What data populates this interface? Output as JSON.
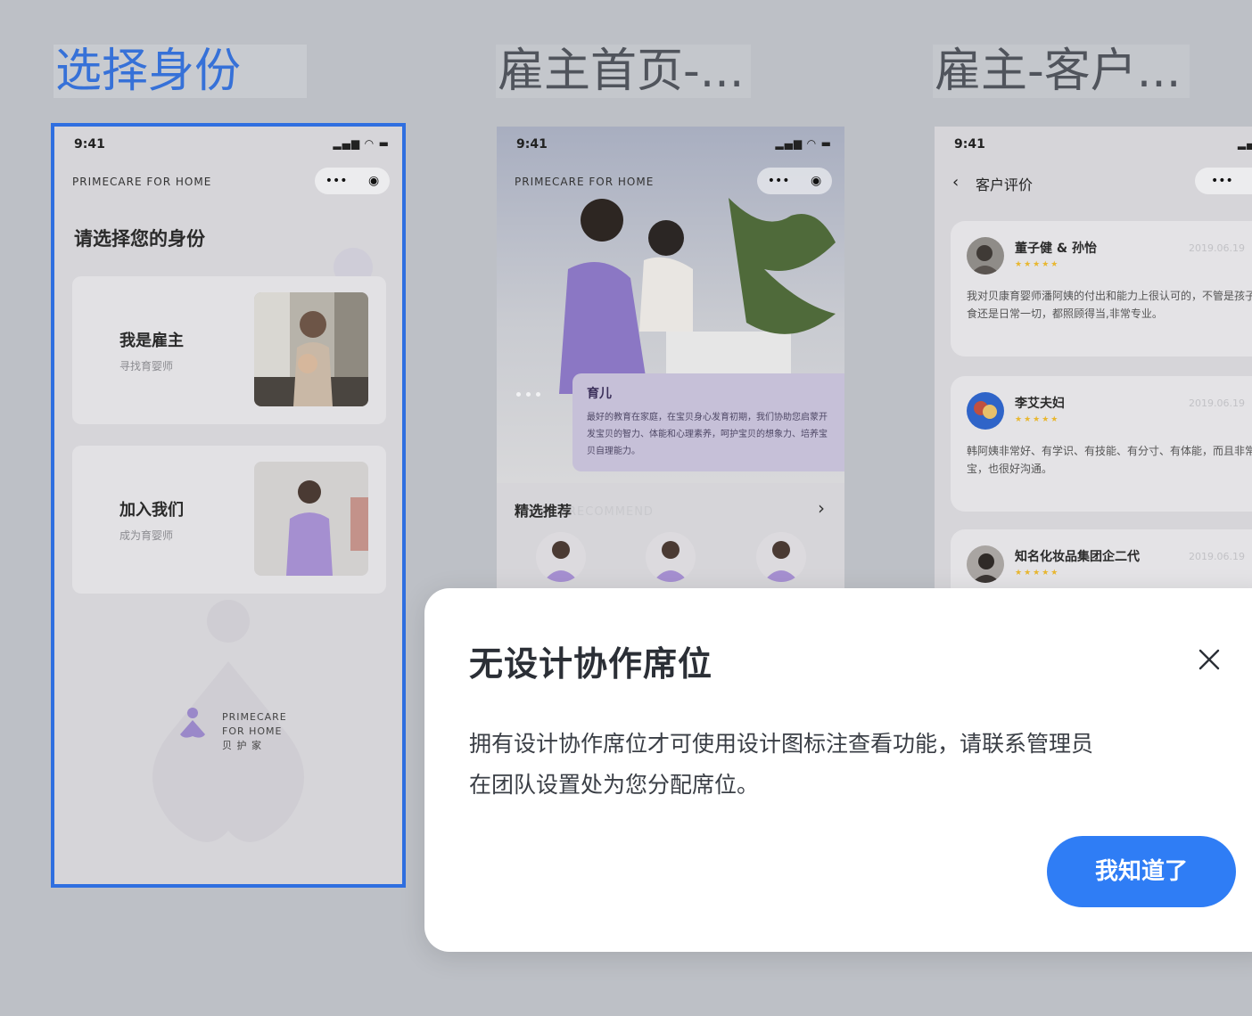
{
  "canvas": {
    "boards": [
      {
        "title": "选择身份"
      },
      {
        "title": "雇主首页-..."
      },
      {
        "title": "雇主-客户..."
      }
    ]
  },
  "phone": {
    "time": "9:41",
    "brand": "PRIMECARE  FOR  HOME",
    "capsule_more": "•••"
  },
  "select_identity": {
    "heading": "请选择您的身份",
    "cards": [
      {
        "title": "我是雇主",
        "subtitle": "寻找育婴师"
      },
      {
        "title": "加入我们",
        "subtitle": "成为育婴师"
      }
    ],
    "logo_lines": [
      "PRIMECARE",
      "FOR  HOME",
      "贝  护  家"
    ]
  },
  "employer_home": {
    "card_title": "育儿",
    "card_desc": "最好的教育在家庭，在宝贝身心发育初期，我们协助您启蒙开发宝贝的智力、体能和心理素养，呵护宝贝的想象力、培养宝贝自理能力。",
    "section_title": "精选推荐",
    "section_ghost": "RECOMMEND"
  },
  "reviews_page": {
    "nav_title": "客户评价",
    "reviews": [
      {
        "name": "董子健 & 孙怡",
        "stars": "★★★★★",
        "date": "2019.06.19",
        "text": "我对贝康育婴师潘阿姨的付出和能力上很认可的，不管是孩子的辅食还是日常一切，都照顾得当,非常专业。"
      },
      {
        "name": "李艾夫妇",
        "stars": "★★★★★",
        "date": "2019.06.19",
        "text": "韩阿姨非常好、有学识、有技能、有分寸、有体能，而且非常爱宝宝，也很好沟通。"
      },
      {
        "name": "知名化妆品集团企二代",
        "stars": "★★★★★",
        "date": "2019.06.19",
        "text": ""
      }
    ]
  },
  "modal": {
    "title": "无设计协作席位",
    "body_line1": "拥有设计协作席位才可使用设计图标注查看功能，请联系管理员",
    "body_line2": "在团队设置处为您分配席位。",
    "ok_label": "我知道了",
    "close_icon": "close-icon",
    "accent": "#2f7df5"
  }
}
